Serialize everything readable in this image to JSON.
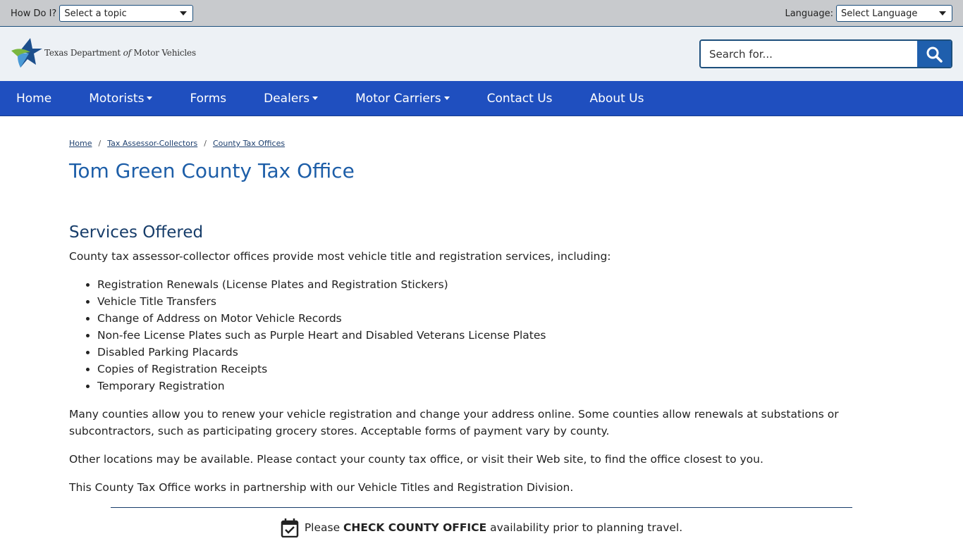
{
  "utility": {
    "how_label": "How Do I?",
    "topic_value": "Select a topic",
    "language_label": "Language:",
    "language_value": "Select Language"
  },
  "header": {
    "logo_text_1": "Texas Department ",
    "logo_text_of": "of",
    "logo_text_2": " Motor Vehicles",
    "search_placeholder": "Search for..."
  },
  "nav": {
    "items": [
      "Home",
      "Motorists",
      "Forms",
      "Dealers",
      "Motor Carriers",
      "Contact Us",
      "About Us"
    ]
  },
  "breadcrumb": [
    "Home",
    "Tax Assessor-Collectors",
    "County Tax Offices"
  ],
  "page_title": "Tom Green County Tax Office",
  "section_heading": "Services Offered",
  "intro": "County tax assessor-collector offices provide most vehicle title and registration services, including:",
  "services": [
    "Registration Renewals (License Plates and Registration Stickers)",
    "Vehicle Title Transfers",
    "Change of Address on Motor Vehicle Records",
    "Non-fee License Plates such as Purple Heart and Disabled Veterans License Plates",
    "Disabled Parking Placards",
    "Copies of Registration Receipts",
    "Temporary Registration"
  ],
  "paragraphs": [
    "Many counties allow you to renew your vehicle registration and change your address online. Some counties allow renewals at substations or subcontractors, such as participating grocery stores. Acceptable forms of payment vary by county.",
    "Other locations may be available. Please contact your county tax office, or visit their Web site, to find the office closest to you.",
    "This County Tax Office works in partnership with our Vehicle Titles and Registration Division."
  ],
  "notice": {
    "prefix": "Please ",
    "bold": "CHECK COUNTY OFFICE",
    "suffix": " availability prior to planning travel."
  },
  "colors": {
    "nav_bg": "#1f4fbf",
    "title": "#1d5ea8",
    "utility_bg": "#c8cacd",
    "header_bg": "#edf1f5"
  }
}
